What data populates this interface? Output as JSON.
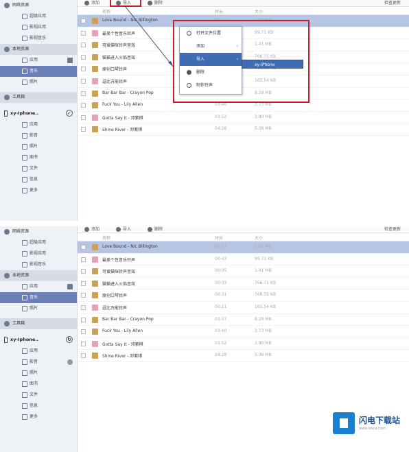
{
  "sidebar": {
    "top_group": "网络资源",
    "top_items": [
      "超级应用",
      "影视应用",
      "影视音乐"
    ],
    "local_group": "本地资源",
    "local_items": [
      "应用",
      "音乐",
      "照片"
    ],
    "toolbox": "工具箱",
    "device_name": "xy-Iphone..",
    "device_items": [
      "应用",
      "影音",
      "照片",
      "图书",
      "文件",
      "信息",
      "更多"
    ]
  },
  "toolbar": {
    "btn1": "添加",
    "btn2": "导入",
    "btn3": "删除",
    "right": "检查更新"
  },
  "columns": {
    "name": "名称",
    "duration": "时长",
    "size": "大小"
  },
  "songs": [
    {
      "title": "Love Bound - Nic Billington",
      "duration": "03:01",
      "size": "2.88 MB"
    },
    {
      "title": "最美个性音乐铃声",
      "duration": "00:43",
      "size": "99.71 KB"
    },
    {
      "title": "可爱猫咪铃声音效",
      "duration": "00:05",
      "size": "1.41 MB"
    },
    {
      "title": "猫猫进入火焰音效",
      "duration": "00:03",
      "size": "766.71 KB"
    },
    {
      "title": "原创口琴铃声",
      "duration": "00:31",
      "size": "769.56 KB"
    },
    {
      "title": "逗比万能铃声",
      "duration": "00:11",
      "size": "165.54 KB"
    },
    {
      "title": "Bar Bar Bar - Crayon Pop",
      "duration": "03:37",
      "size": "8.29 MB"
    },
    {
      "title": "Fuck You - Lily Allen",
      "duration": "03:40",
      "size": "3.73 MB"
    },
    {
      "title": "Gotta Say It - 邓紫棋",
      "duration": "03:52",
      "size": "3.89 MB"
    },
    {
      "title": "Shine River - 邓紫棋",
      "duration": "04:28",
      "size": "5.08 MB"
    }
  ],
  "context_menu": {
    "items": [
      "打开文件位置",
      "添加",
      "导入",
      "删除",
      "制作铃声"
    ],
    "submenu": "xy-iPhone"
  },
  "watermark": {
    "title": "闪电下载站",
    "url": "www.sdxia.com"
  },
  "colors": {
    "highlight_red": "#c31f2b",
    "menu_blue": "#3e6db4",
    "selection": "#b7c5e4"
  }
}
